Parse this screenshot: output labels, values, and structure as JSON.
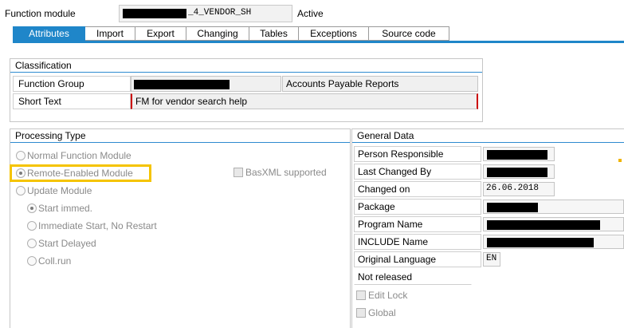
{
  "header": {
    "function_module_label": "Function module",
    "function_module_value": "_4_VENDOR_SH",
    "status": "Active"
  },
  "tabs": [
    {
      "label": "Attributes",
      "active": true
    },
    {
      "label": "Import"
    },
    {
      "label": "Export"
    },
    {
      "label": "Changing"
    },
    {
      "label": "Tables"
    },
    {
      "label": "Exceptions"
    },
    {
      "label": "Source code"
    }
  ],
  "classification": {
    "title": "Classification",
    "function_group_label": "Function Group",
    "function_group_desc": "Accounts Payable Reports",
    "short_text_label": "Short Text",
    "short_text_value": "FM for vendor search help"
  },
  "processing_type": {
    "title": "Processing Type",
    "normal": "Normal Function Module",
    "remote": "Remote-Enabled Module",
    "basxml": "BasXML supported",
    "update": "Update Module",
    "start_immed": "Start immed.",
    "immediate_no_restart": "Immediate Start, No Restart",
    "start_delayed": "Start Delayed",
    "coll_run": "Coll.run"
  },
  "general_data": {
    "title": "General Data",
    "person_responsible_label": "Person Responsible",
    "last_changed_by_label": "Last Changed By",
    "changed_on_label": "Changed on",
    "changed_on_value": "26.06.2018",
    "package_label": "Package",
    "program_name_label": "Program Name",
    "include_name_label": "INCLUDE Name",
    "original_language_label": "Original Language",
    "original_language_value": "EN",
    "release_status": "Not released",
    "edit_lock": "Edit Lock",
    "global": "Global"
  },
  "colors": {
    "tab_active": "#1f86c9",
    "highlight": "#f5c400"
  }
}
